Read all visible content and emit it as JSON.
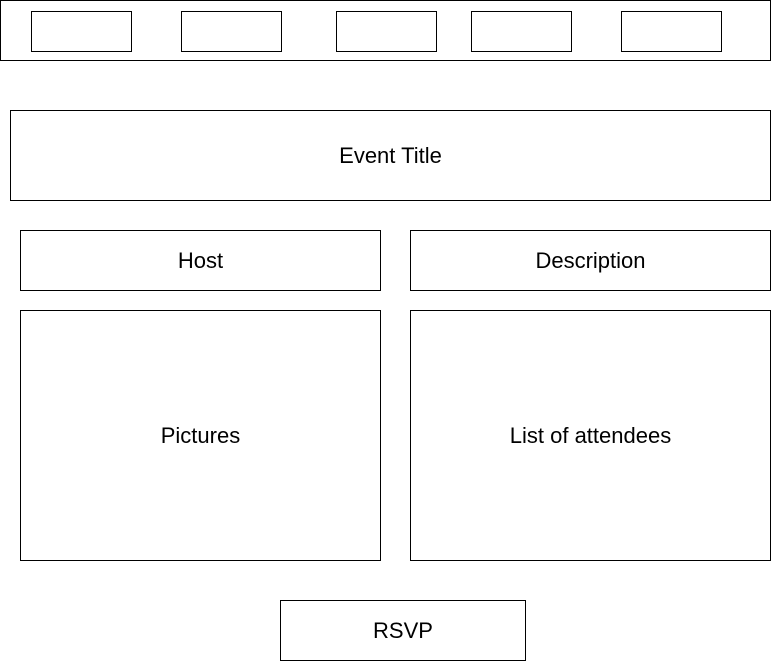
{
  "nav": {
    "slots": [
      "",
      "",
      "",
      "",
      ""
    ]
  },
  "event": {
    "title": "Event Title",
    "host": "Host",
    "description": "Description",
    "pictures": "Pictures",
    "attendees": "List of attendees"
  },
  "actions": {
    "rsvp": "RSVP"
  }
}
